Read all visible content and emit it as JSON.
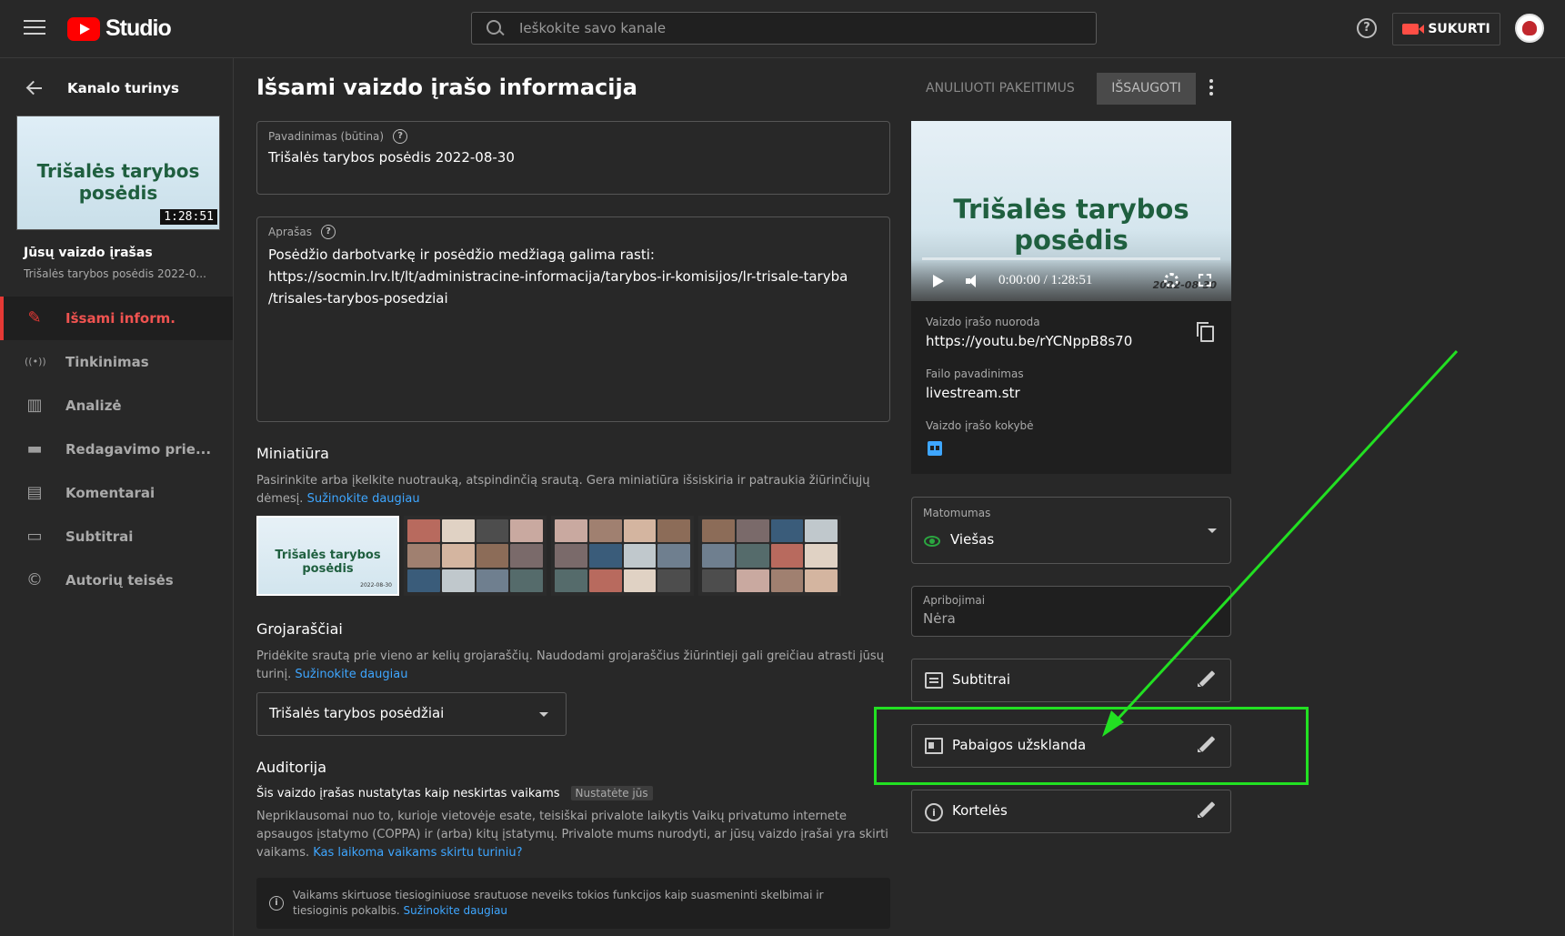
{
  "header": {
    "logo_text": "Studio",
    "search_placeholder": "Ieškokite savo kanale",
    "create_label": "SUKURTI"
  },
  "sidebar": {
    "back_label": "Kanalo turinys",
    "thumb_title": "Trišalės tarybos posėdis",
    "thumb_duration": "1:28:51",
    "video_label": "Jūsų vaizdo įrašas",
    "video_subtitle": "Trišalės tarybos posėdis 2022-0...",
    "items": [
      {
        "label": "Išsami inform.",
        "icon": "pencil-icon",
        "glyph": "✎",
        "active": true
      },
      {
        "label": "Tinkinimas",
        "icon": "broadcast-icon",
        "glyph": "((•))",
        "active": false
      },
      {
        "label": "Analizė",
        "icon": "analytics-icon",
        "glyph": "▥",
        "active": false
      },
      {
        "label": "Redagavimo prie...",
        "icon": "film-icon",
        "glyph": "▬",
        "active": false
      },
      {
        "label": "Komentarai",
        "icon": "comment-icon",
        "glyph": "▤",
        "active": false
      },
      {
        "label": "Subtitrai",
        "icon": "subtitles-icon",
        "glyph": "▭",
        "active": false
      },
      {
        "label": "Autorių teisės",
        "icon": "copyright-icon",
        "glyph": "©",
        "active": false
      }
    ]
  },
  "main": {
    "title": "Išsami vaizdo įrašo informacija",
    "undo_label": "ANULIUOTI PAKEITIMUS",
    "save_label": "IŠSAUGOTI",
    "title_field": {
      "label": "Pavadinimas (būtina)",
      "value": "Trišalės tarybos posėdis 2022-08-30"
    },
    "description_field": {
      "label": "Aprašas",
      "lines": [
        "Posėdžio darbotvarkę ir posėdžio medžiagą galima rasti:",
        "https://socmin.lrv.lt/lt/administracine-informacija/tarybos-ir-komisijos/lr-trisale-taryba",
        "/trisales-tarybos-posedziai"
      ]
    },
    "thumbnail": {
      "title": "Miniatiūra",
      "text": "Pasirinkite arba įkelkite nuotrauką, atspindinčią srautą. Gera miniatiūra išsiskiria ir patraukia žiūrinčiųjų dėmesį.",
      "link": "Sužinokite daugiau",
      "selected_title": "Trišalės tarybos posėdis",
      "selected_date": "2022-08-30"
    },
    "playlists": {
      "title": "Grojaraščiai",
      "text": "Pridėkite srautą prie vieno ar kelių grojaraščių. Naudodami grojaraščius žiūrintieji gali greičiau atrasti jūsų turinį.",
      "link": "Sužinokite daugiau",
      "selected": "Trišalės tarybos posėdžiai"
    },
    "audience": {
      "title": "Auditorija",
      "status": "Šis vaizdo įrašas nustatytas kaip neskirtas vaikams",
      "badge": "Nustatėte jūs",
      "text": "Nepriklausomai nuo to, kurioje vietovėje esate, teisiškai privalote laikytis Vaikų privatumo internete apsaugos įstatymo (COPPA) ir (arba) kitų įstatymų. Privalote mums nurodyti, ar jūsų vaizdo įrašai yra skirti vaikams.",
      "link": "Kas laikoma vaikams skirtu turiniu?",
      "info": "Vaikams skirtuose tiesioginiuose srautuose neveiks tokios funkcijos kaip suasmeninti skelbimai ir tiesioginis pokalbis.",
      "info_link": "Sužinokite daugiau"
    }
  },
  "right": {
    "player_title": "Trišalės tarybos posėdis",
    "player_time": "0:00:00 / 1:28:51",
    "player_date": "2022-08-30",
    "link_label": "Vaizdo įrašo nuoroda",
    "link_value": "https://youtu.be/rYCNppB8s70",
    "file_label": "Failo pavadinimas",
    "file_value": "livestream.str",
    "quality_label": "Vaizdo įrašo kokybė",
    "visibility_label": "Matomumas",
    "visibility_value": "Viešas",
    "restrictions_label": "Apribojimai",
    "restrictions_value": "Nėra",
    "rows": {
      "subtitles": "Subtitrai",
      "endscreen": "Pabaigos užsklanda",
      "cards": "Kortelės"
    }
  },
  "colors": {
    "accent_red": "#ff0000",
    "link_blue": "#3ea6ff",
    "annotation_green": "#22e022"
  }
}
